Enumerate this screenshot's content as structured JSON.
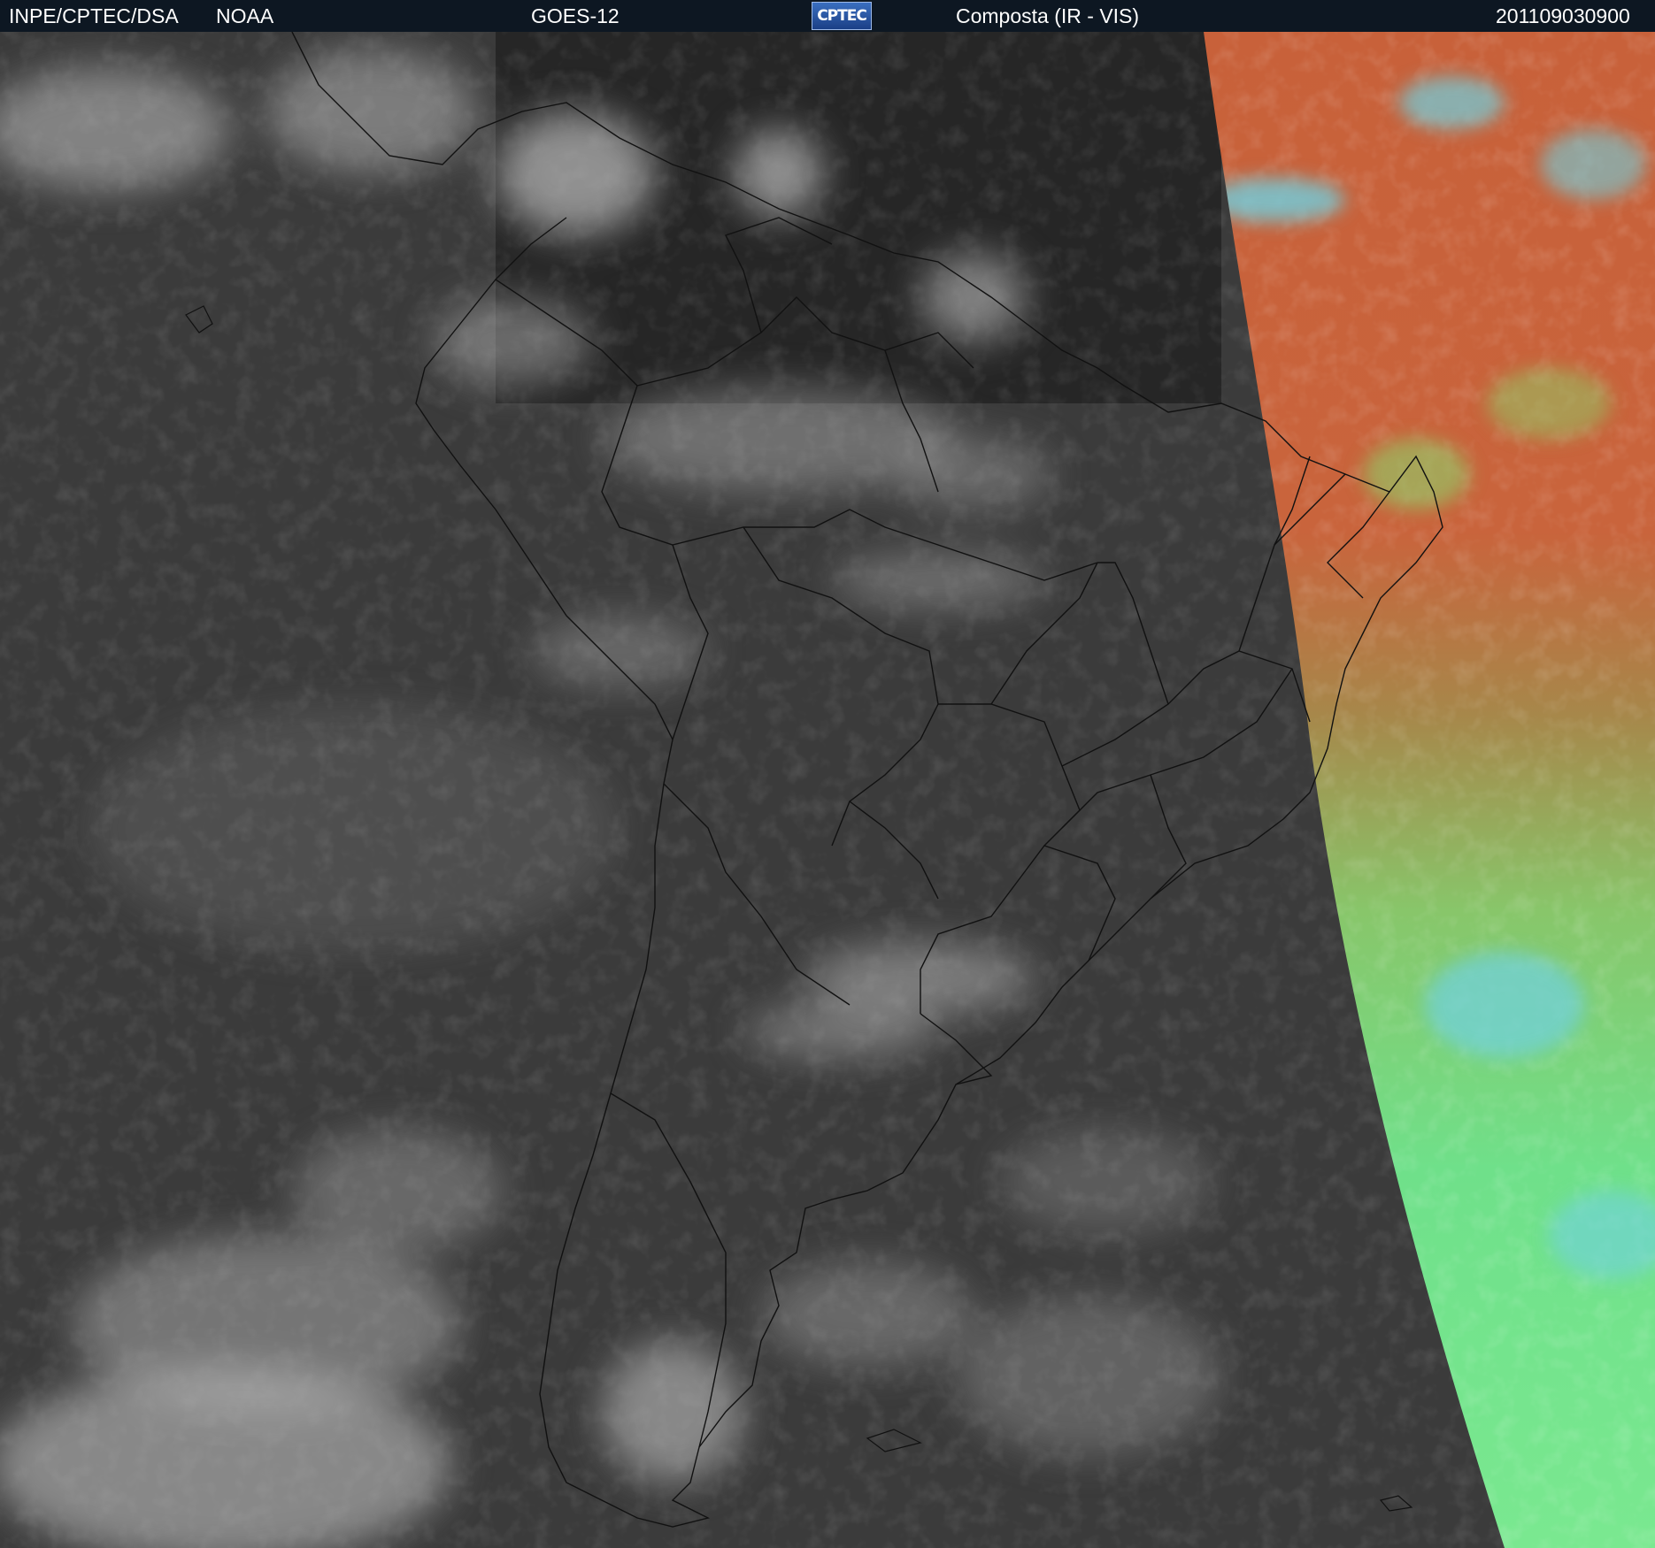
{
  "header": {
    "org": "INPE/CPTEC/DSA",
    "agency": "NOAA",
    "satellite": "GOES-12",
    "logo_text": "CPTEC",
    "product": "Composta (IR - VIS)",
    "timestamp": "201109030900"
  },
  "colors": {
    "header_bg": "#0d1722",
    "ir_background": "#3a3a3a",
    "vis_warm": "#c8613a",
    "vis_green": "#6fe08a",
    "vis_cyan": "#6fd0e0",
    "borders": "#111111"
  }
}
